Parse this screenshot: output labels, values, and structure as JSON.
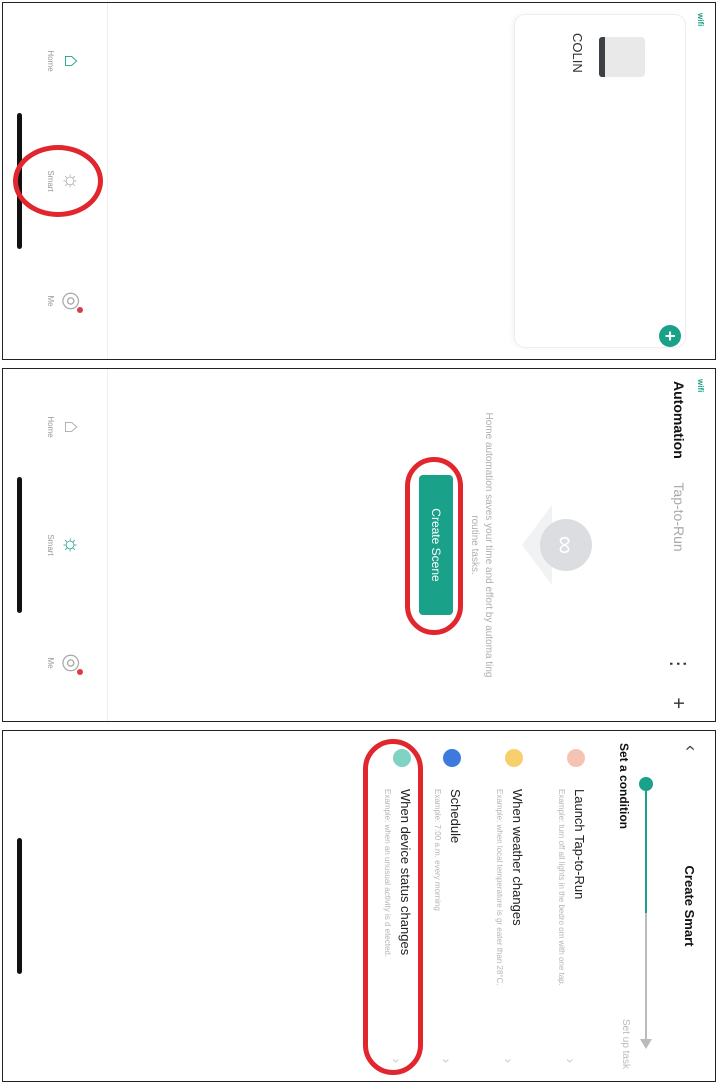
{
  "screen1": {
    "status_text": "wifi",
    "device_name": "COLIN",
    "nav": {
      "home": "Home",
      "smart": "Smart",
      "me": "Me"
    }
  },
  "screen2": {
    "status_text": "wifi",
    "tab_automation": "Automation",
    "tab_tap_to_run": "Tap-to-Run",
    "add_icon": "+",
    "more_icon": "⋮",
    "empty_message": "Home automation saves your time and effort by automa ting routine tasks.",
    "create_button": "Create Scene",
    "nav": {
      "home": "Home",
      "smart": "Smart",
      "me": "Me"
    }
  },
  "screen3": {
    "title": "Create Smart",
    "back_icon": "‹",
    "step1": "Set a condition",
    "step2": "Set up task",
    "conditions": [
      {
        "title": "Launch Tap-to-Run",
        "desc": "Example: turn off all lights in the bedro om with one tap.",
        "icon": "hand-tap-icon",
        "color": "#f0886a"
      },
      {
        "title": "When weather changes",
        "desc": "Example: when local temperature is gr eater than 28°C.",
        "icon": "sun-icon",
        "color": "#f5b73a"
      },
      {
        "title": "Schedule",
        "desc": "Example: 7:00 a.m. every morning",
        "icon": "clock-icon",
        "color": "#3c7bdb"
      },
      {
        "title": "When device status changes",
        "desc": "Example: when an unusual activity is d etected.",
        "icon": "device-bulb-icon",
        "color": "#1aa18a"
      }
    ]
  }
}
